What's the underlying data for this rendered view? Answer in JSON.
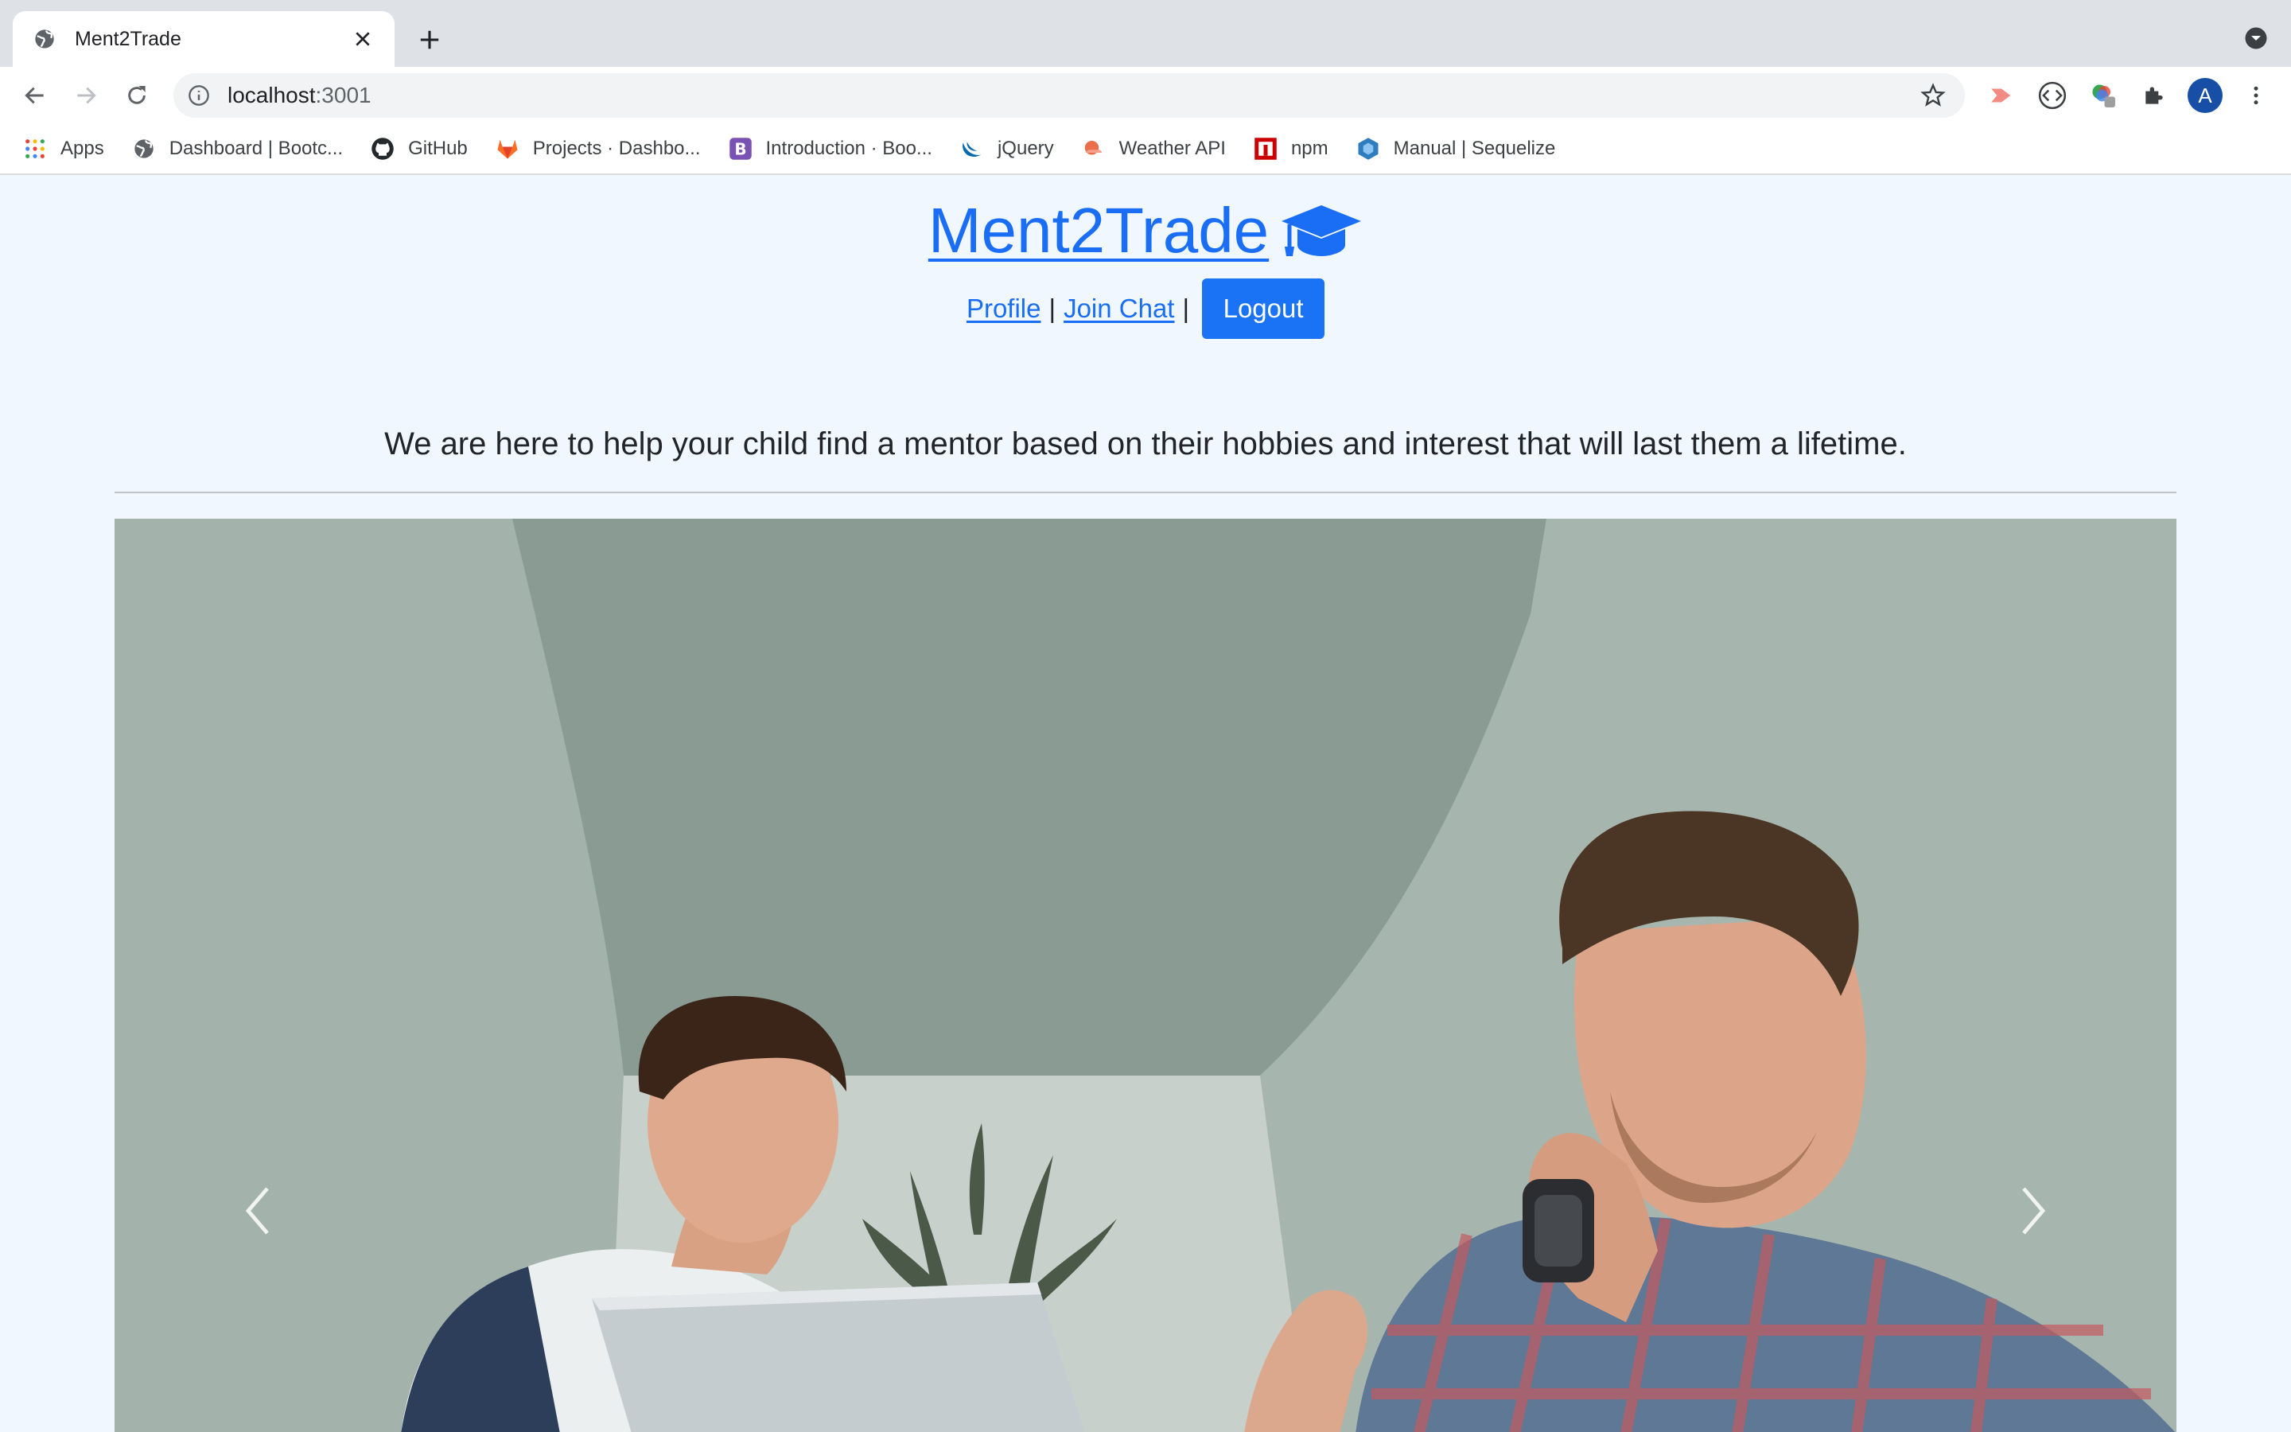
{
  "browser": {
    "tab": {
      "title": "Ment2Trade",
      "favicon": "globe-icon"
    },
    "address": {
      "host": "localhost",
      "port": ":3001"
    },
    "bookmarks": [
      {
        "label": "Apps",
        "icon": "apps-grid-icon"
      },
      {
        "label": "Dashboard | Bootc...",
        "icon": "globe-icon"
      },
      {
        "label": "GitHub",
        "icon": "github-icon"
      },
      {
        "label": "Projects · Dashbo...",
        "icon": "gitlab-icon"
      },
      {
        "label": "Introduction · Boo...",
        "icon": "bootstrap-icon"
      },
      {
        "label": "jQuery",
        "icon": "jquery-icon"
      },
      {
        "label": "Weather API",
        "icon": "weather-icon"
      },
      {
        "label": "npm",
        "icon": "npm-icon"
      },
      {
        "label": "Manual | Sequelize",
        "icon": "sequelize-icon"
      }
    ],
    "profile_initial": "A",
    "colors": {
      "tabstrip": "#dee1e6",
      "accent": "#1a73e8"
    }
  },
  "header": {
    "brand": "Ment2Trade",
    "brand_icon": "graduation-cap-icon",
    "nav": {
      "profile": "Profile",
      "separator": "|",
      "join_chat": "Join Chat",
      "logout": "Logout"
    }
  },
  "main": {
    "tagline": "We are here to help your child find a mentor based on their hobbies and interest that will last them a lifetime.",
    "carousel": {
      "image_alt": "Mentor and student looking at a laptop",
      "prev_icon": "chevron-left-icon",
      "next_icon": "chevron-right-icon"
    }
  },
  "colors": {
    "link": "#1a6ef5",
    "button": "#1a73f5",
    "page_bg": "#f0f7fe"
  }
}
